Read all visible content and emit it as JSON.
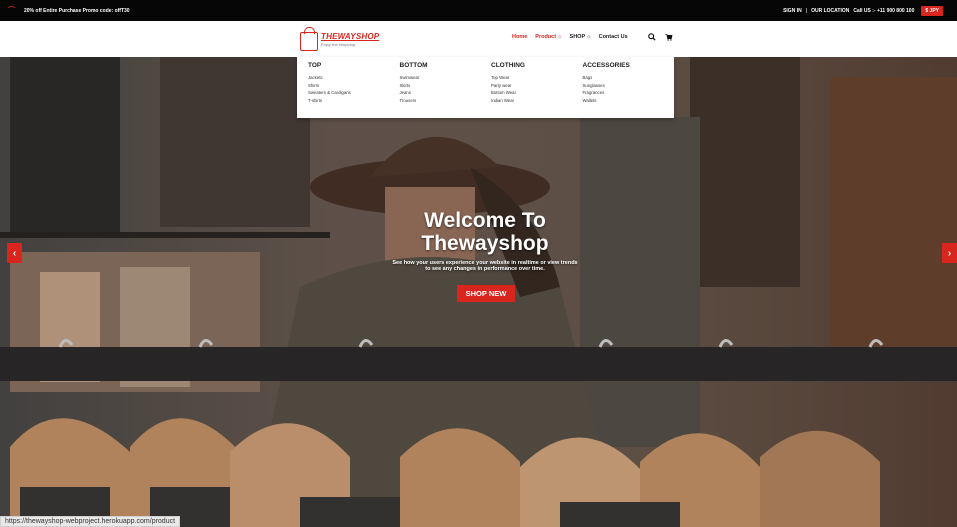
{
  "topbar": {
    "promo_text": "20% off Entire Purchase Promo code: offT30",
    "sign_in": "SIGN IN",
    "separator": "|",
    "location": "OUR LOCATION",
    "call": "Call US :- +11 900 800 100",
    "currency": "$ JPY"
  },
  "navbar": {
    "brand": "THEWAYSHOP",
    "tagline": "Enjoy the shopping",
    "menu": [
      {
        "label": "Home",
        "active": true
      },
      {
        "label": "Product",
        "caret": "◇"
      },
      {
        "label": "SHOP",
        "caret": "◇"
      },
      {
        "label": "Contact Us"
      }
    ],
    "search_icon": "search-icon",
    "cart_icon": "cart-icon"
  },
  "dropdown": {
    "columns": [
      {
        "title": "TOP",
        "links": [
          "Jackets",
          "Shirts",
          "Sweaters & Cardigans",
          "T-shirts"
        ]
      },
      {
        "title": "BOTTOM",
        "links": [
          "Swimwear",
          "Skirts",
          "Jeans",
          "Trousers"
        ]
      },
      {
        "title": "CLOTHING",
        "links": [
          "Top Wear",
          "Party wear",
          "Bottom Wear",
          "Indian Wear"
        ]
      },
      {
        "title": "ACCESSORIES",
        "links": [
          "Bags",
          "Sunglasses",
          "Fragrances",
          "Wallets"
        ]
      }
    ]
  },
  "hero": {
    "title_line1": "Welcome To",
    "title_line2": "Thewayshop",
    "subtitle": "See how your users experience your website in realtime or view trends to see any changes in performance over time.",
    "button": "SHOP NEW",
    "prev_arrow": "‹",
    "next_arrow": "›"
  },
  "status_url": "https://thewayshop-webproject.herokuapp.com/product",
  "colors": {
    "accent": "#d8251d",
    "topbar": "#060606"
  }
}
